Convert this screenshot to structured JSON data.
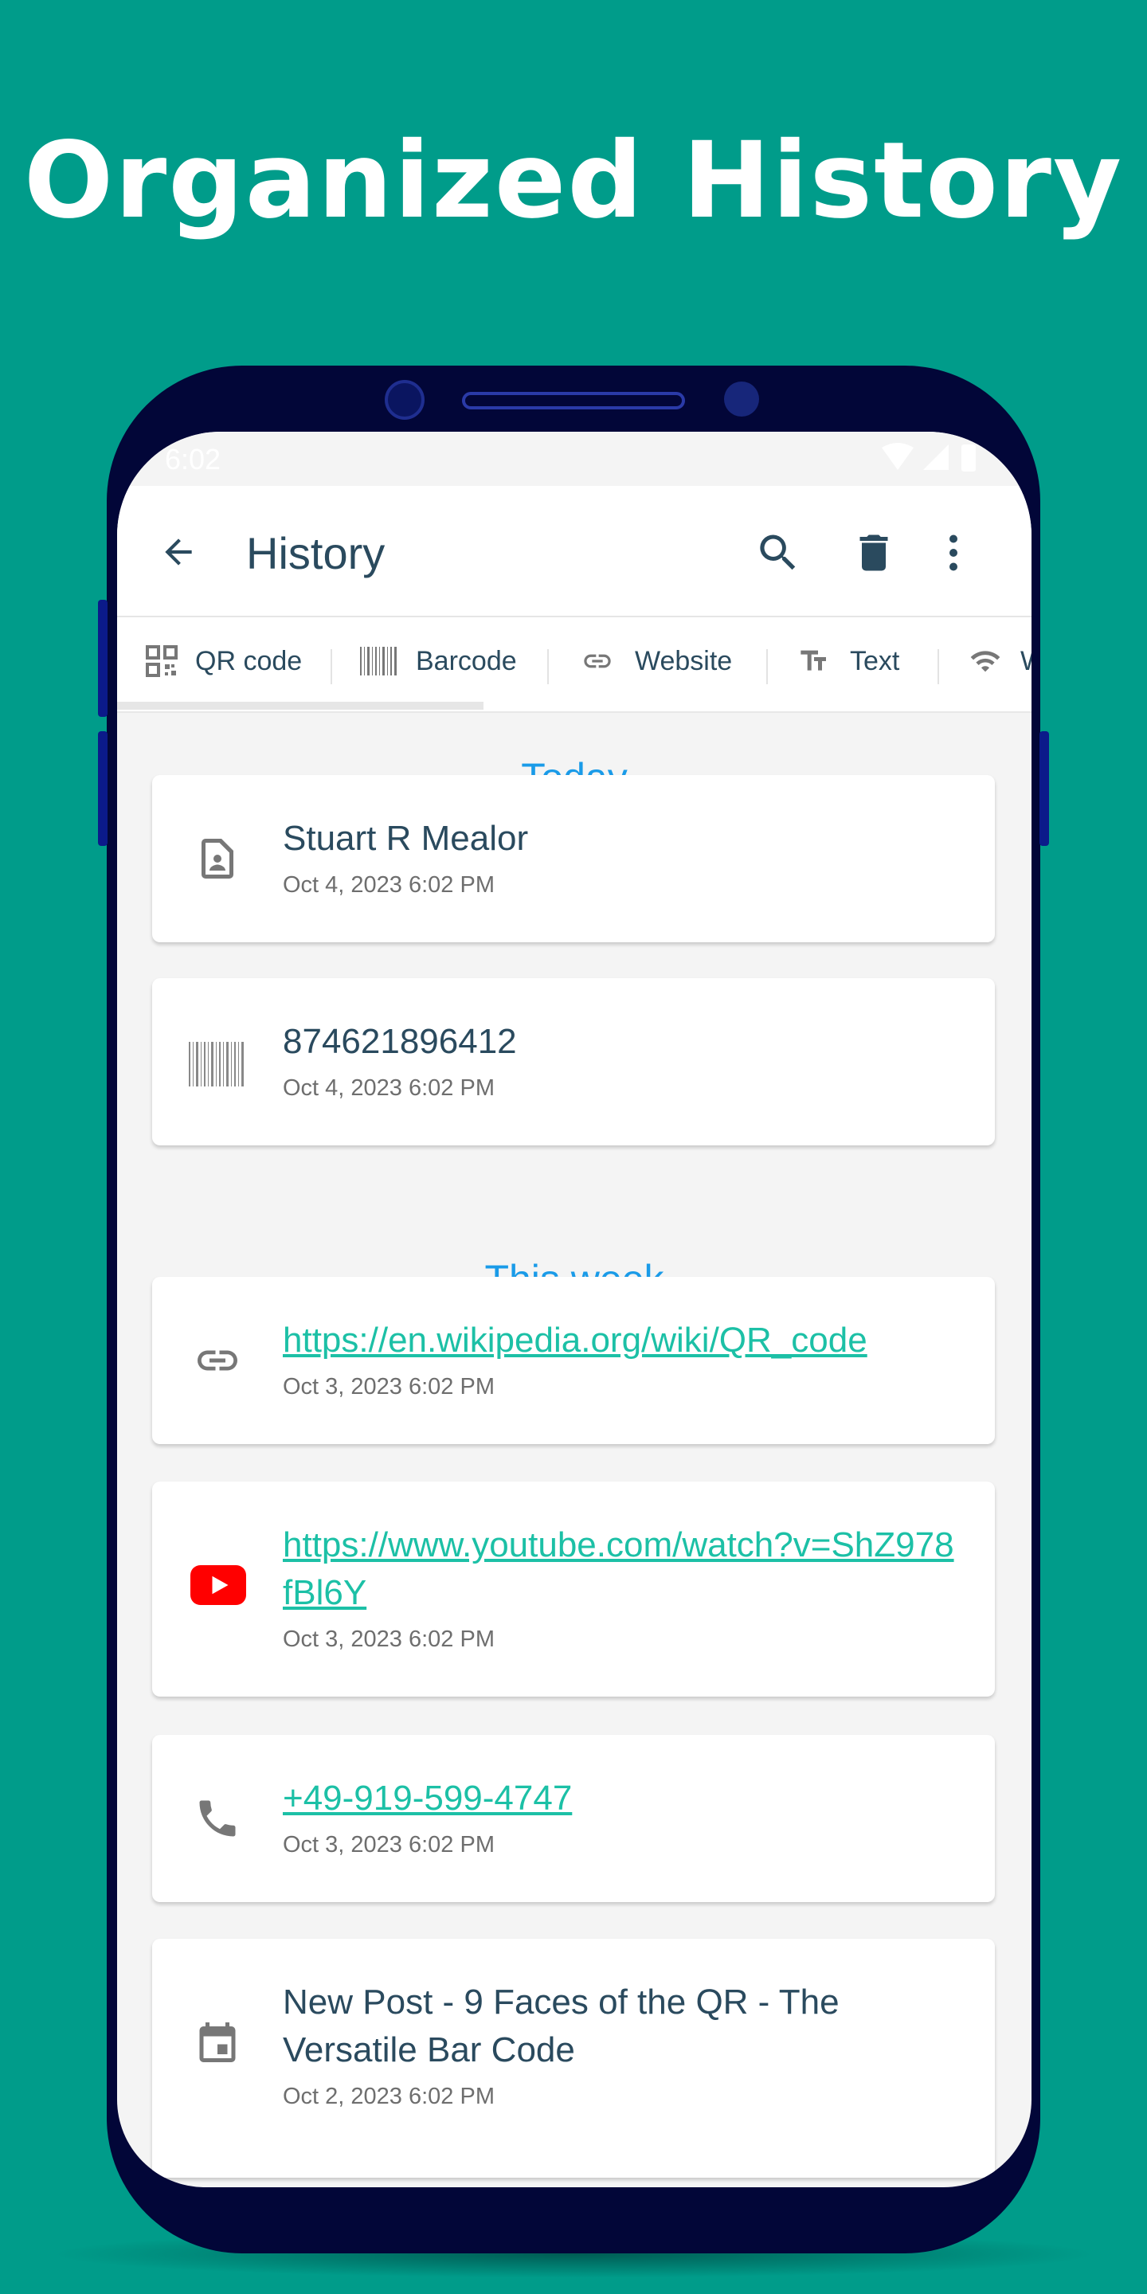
{
  "headline": "Organized History",
  "status_bar": {
    "time": "6:02"
  },
  "app_bar": {
    "title": "History",
    "icons": [
      "back-arrow-icon",
      "search-icon",
      "delete-icon",
      "more-vert-icon"
    ]
  },
  "tabs": [
    {
      "label": "QR code",
      "icon": "qr-code-icon",
      "selected": true
    },
    {
      "label": "Barcode",
      "icon": "barcode-icon"
    },
    {
      "label": "Website",
      "icon": "link-icon"
    },
    {
      "label": "Text",
      "icon": "text-icon"
    },
    {
      "label": "W",
      "icon": "wifi-icon"
    }
  ],
  "sections": [
    {
      "label": "Today"
    },
    {
      "label": "This week"
    }
  ],
  "items": [
    {
      "title": "Stuart R Mealor",
      "date": "Oct 4, 2023 6:02 PM",
      "icon": "contact-icon"
    },
    {
      "title": "874621896412",
      "date": "Oct 4, 2023 6:02 PM",
      "icon": "barcode-icon"
    },
    {
      "title": "https://en.wikipedia.org/wiki/QR_code",
      "date": "Oct 3, 2023 6:02 PM",
      "icon": "link-icon",
      "link": true
    },
    {
      "title": "https://www.youtube.com/watch?v=ShZ978fBl6Y",
      "date": "Oct 3, 2023 6:02 PM",
      "icon": "youtube-icon",
      "link": true
    },
    {
      "title": "+49-919-599-4747",
      "date": "Oct 3, 2023 6:02 PM",
      "icon": "phone-icon",
      "link": true
    },
    {
      "title": "New Post - 9 Faces of the QR - The Versatile Bar Code",
      "date": "Oct 2, 2023 6:02 PM",
      "icon": "calendar-icon"
    }
  ],
  "colors": {
    "background": "#009c8a",
    "phone": "#020638",
    "section": "#1a9be8",
    "link": "#1cc0a6",
    "text": "#2a4a5e"
  }
}
